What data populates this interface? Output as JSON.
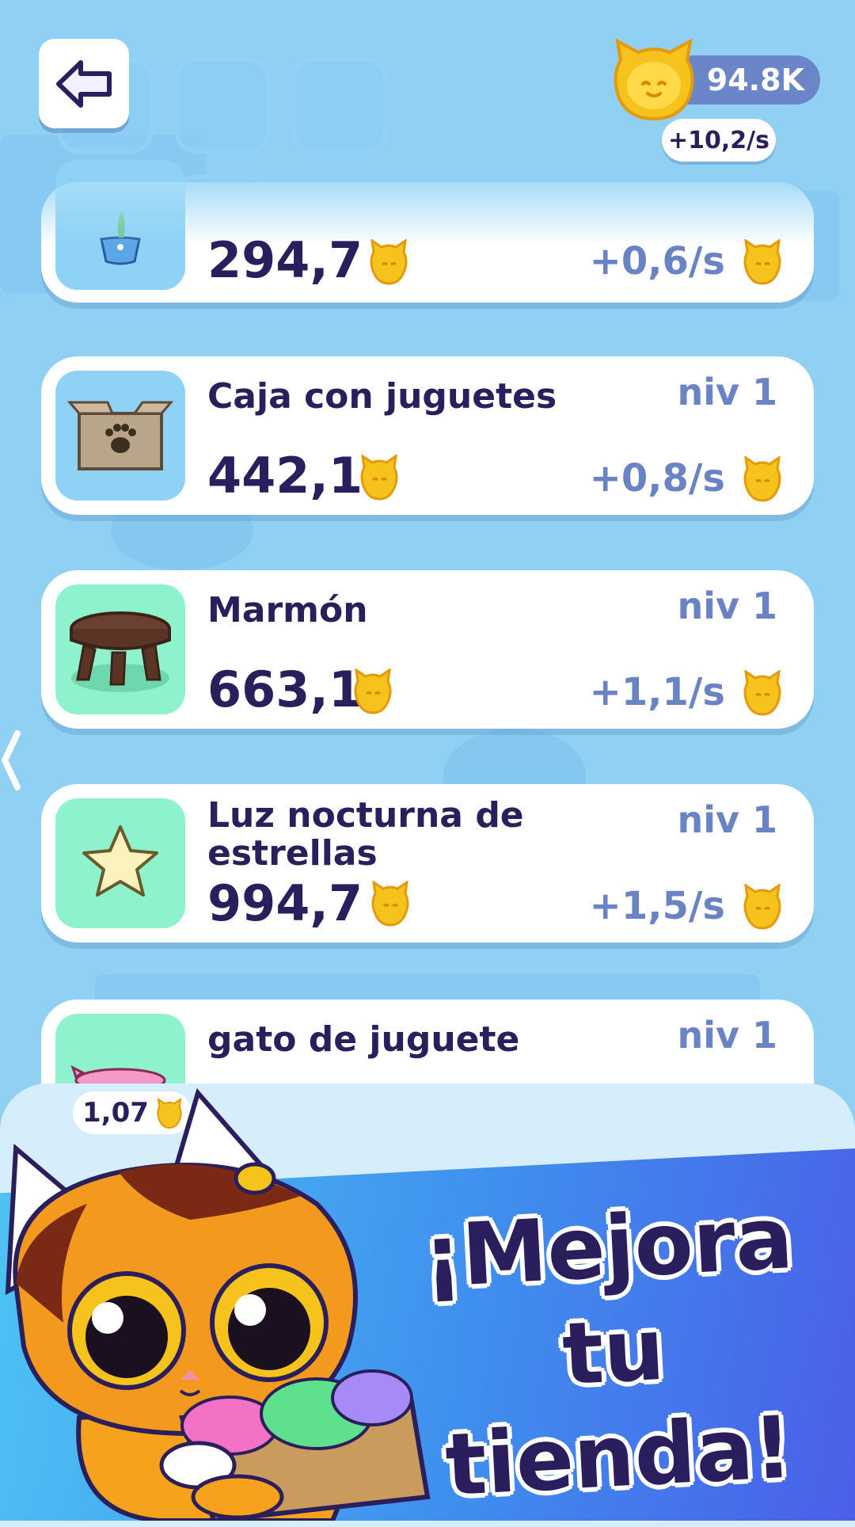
{
  "header": {
    "coins": "94.8K",
    "rate": "+10,2/s"
  },
  "items": [
    {
      "name": "",
      "price": "294,7",
      "rate": "+0,6/s",
      "level": "",
      "icon": "flowerpot-icon"
    },
    {
      "name": "Caja con juguetes",
      "price": "442,1",
      "rate": "+0,8/s",
      "level": "niv 1",
      "icon": "toy-box-icon"
    },
    {
      "name": "Marmón",
      "price": "663,1",
      "rate": "+1,1/s",
      "level": "niv 1",
      "icon": "stool-icon"
    },
    {
      "name": "Luz nocturna de estrellas",
      "price": "994,7",
      "rate": "+1,5/s",
      "level": "niv 1",
      "icon": "star-icon"
    },
    {
      "name": "gato de juguete",
      "price": "",
      "rate": "",
      "level": "niv 1",
      "icon": "toy-cat-icon"
    }
  ],
  "bottom": {
    "mini_price": "1,07"
  },
  "promo": {
    "line1": "¡Mejora tu",
    "line2": "tienda!"
  },
  "colors": {
    "background": "#8fd0f3",
    "text_dark": "#2a1e5c",
    "text_muted": "#6a83c4",
    "thumb_blue": "#8ed2f6",
    "thumb_green": "#8ef2cc",
    "coin_gold": "#f6c21c"
  }
}
